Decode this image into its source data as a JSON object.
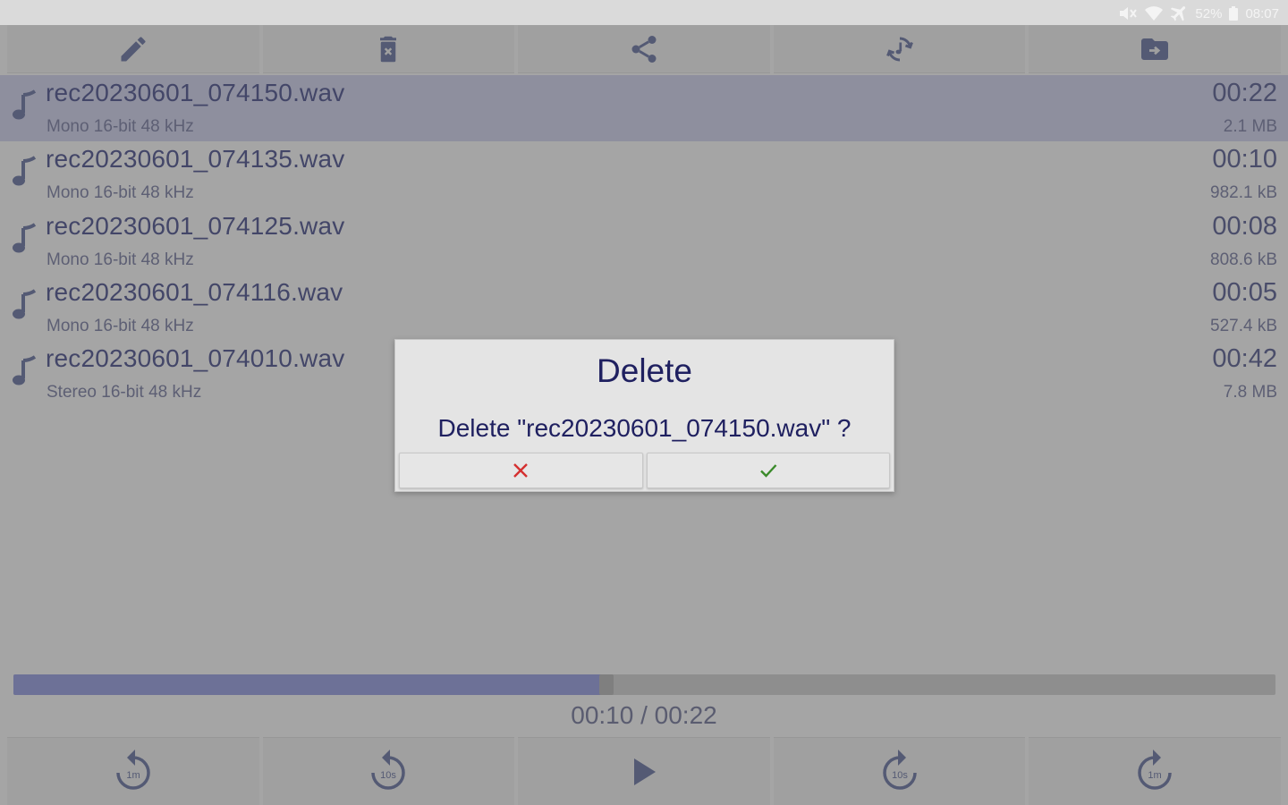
{
  "status_bar": {
    "battery": "52%",
    "clock": "08:07",
    "icons": [
      "mute-icon",
      "wifi-icon",
      "airplane-icon",
      "battery-icon"
    ]
  },
  "toolbar": {
    "buttons": [
      {
        "icon": "pencil-icon",
        "action": "rename"
      },
      {
        "icon": "trash-icon",
        "action": "delete"
      },
      {
        "icon": "share-icon",
        "action": "share"
      },
      {
        "icon": "convert-icon",
        "action": "convert"
      },
      {
        "icon": "folder-move-icon",
        "action": "move"
      }
    ]
  },
  "recordings": [
    {
      "name": "rec20230601_074150.wav",
      "format": "Mono 16-bit 48 kHz",
      "duration": "00:22",
      "size": "2.1 MB",
      "selected": true
    },
    {
      "name": "rec20230601_074135.wav",
      "format": "Mono 16-bit 48 kHz",
      "duration": "00:10",
      "size": "982.1 kB",
      "selected": false
    },
    {
      "name": "rec20230601_074125.wav",
      "format": "Mono 16-bit 48 kHz",
      "duration": "00:08",
      "size": "808.6 kB",
      "selected": false
    },
    {
      "name": "rec20230601_074116.wav",
      "format": "Mono 16-bit 48 kHz",
      "duration": "00:05",
      "size": "527.4 kB",
      "selected": false
    },
    {
      "name": "rec20230601_074010.wav",
      "format": "Stereo 16-bit 48 kHz",
      "duration": "00:42",
      "size": "7.8 MB",
      "selected": false
    }
  ],
  "dialog": {
    "title": "Delete",
    "message": "Delete \"rec20230601_074150.wav\" ?",
    "cancel_icon": "close-icon",
    "confirm_icon": "check-icon"
  },
  "player": {
    "progress_fraction": 0.47,
    "time_label": "00:10 / 00:22"
  },
  "bottom_bar": {
    "buttons": [
      {
        "icon": "rewind-1m-icon",
        "label": "1m"
      },
      {
        "icon": "rewind-10s-icon",
        "label": "10s"
      },
      {
        "icon": "play-icon",
        "label": ""
      },
      {
        "icon": "forward-10s-icon",
        "label": "10s"
      },
      {
        "icon": "forward-1m-icon",
        "label": "1m"
      }
    ]
  },
  "colors": {
    "accent": "#6d7197",
    "text_dark": "#1f2060",
    "cancel_red": "#d43030",
    "confirm_green": "#3a8a2a"
  }
}
